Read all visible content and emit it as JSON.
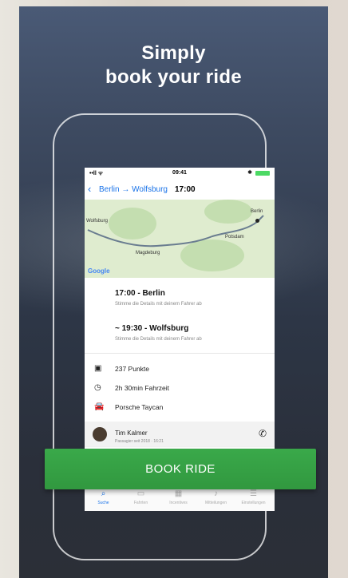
{
  "headline": {
    "line1": "Simply",
    "line2": "book your ride"
  },
  "status_bar": {
    "signal": "••ll ᯤ",
    "time": "09:41",
    "bluetooth": "✱"
  },
  "nav": {
    "back_icon": "chevron-left-icon",
    "route": "Berlin → Wolfsburg",
    "time": "17:00"
  },
  "map": {
    "labels": {
      "wolfsburg": "Wolfsburg",
      "magdeburg": "Magdeburg",
      "berlin": "Berlin",
      "potsdam": "Potsdam"
    },
    "attribution": "Google"
  },
  "stops": [
    {
      "title": "17:00 - Berlin",
      "subtitle": "Stimme die Details mit deinem Fahrer ab"
    },
    {
      "title": "~ 19:30 - Wolfsburg",
      "subtitle": "Stimme die Details mit deinem Fahrer ab"
    }
  ],
  "info": [
    {
      "icon": "points-icon",
      "text": "237 Punkte"
    },
    {
      "icon": "clock-icon",
      "text": "2h 30min Fahrzeit"
    },
    {
      "icon": "car-icon",
      "text": "Porsche Taycan"
    }
  ],
  "driver": {
    "name": "Tim Kalmer",
    "subtitle": "Passagier seit 2018 · 16:21",
    "call_icon": "phone-icon"
  },
  "tabs": [
    {
      "label": "Suche",
      "icon": "search-icon",
      "active": true
    },
    {
      "label": "Fahrten",
      "icon": "car-icon",
      "active": false
    },
    {
      "label": "Incentives",
      "icon": "gift-icon",
      "active": false
    },
    {
      "label": "Mitteilungen",
      "icon": "bell-icon",
      "active": false
    },
    {
      "label": "Einstellungen",
      "icon": "settings-icon",
      "active": false
    }
  ],
  "book_button": {
    "label": "BOOK RIDE"
  },
  "colors": {
    "accent": "#34a853",
    "link": "#1a73e8",
    "background_top": "#4a5a76"
  }
}
